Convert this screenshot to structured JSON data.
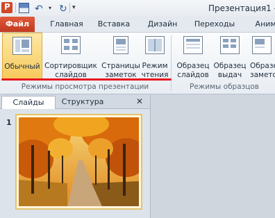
{
  "window": {
    "title": "Презентация1 -"
  },
  "quick_access": {
    "save": "save-icon",
    "undo": "undo-icon",
    "redo": "redo-icon"
  },
  "tabs": {
    "file": "Файл",
    "home": "Главная",
    "insert": "Вставка",
    "design": "Дизайн",
    "transitions": "Переходы",
    "animations": "Анима"
  },
  "ribbon": {
    "views_group": {
      "label": "Режимы просмотра презентации",
      "buttons": [
        {
          "line1": "Обычный",
          "line2": ""
        },
        {
          "line1": "Сортировщик",
          "line2": "слайдов"
        },
        {
          "line1": "Страницы",
          "line2": "заметок"
        },
        {
          "line1": "Режим",
          "line2": "чтения"
        }
      ]
    },
    "master_group": {
      "label": "Режимы образцов",
      "buttons": [
        {
          "line1": "Образец",
          "line2": "слайдов"
        },
        {
          "line1": "Образец",
          "line2": "выдач"
        },
        {
          "line1": "Образец",
          "line2": "замето"
        }
      ]
    }
  },
  "pane": {
    "tab_slides": "Слайды",
    "tab_outline": "Структура",
    "close": "✕",
    "slide_number": "1"
  },
  "colors": {
    "file_tab": "#c23a1f",
    "active_button": "#f7c95a",
    "highlight": "#e8121f"
  }
}
